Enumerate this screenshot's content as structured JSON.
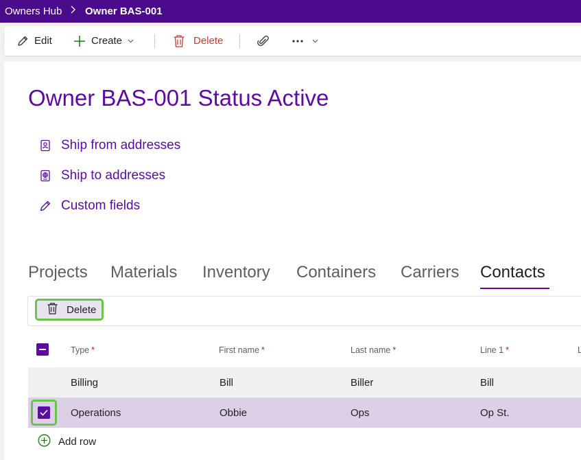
{
  "breadcrumb": {
    "root": "Owners Hub",
    "current": "Owner BAS-001"
  },
  "commands": {
    "edit": "Edit",
    "create": "Create",
    "delete": "Delete"
  },
  "record": {
    "title": "Owner BAS-001 Status Active"
  },
  "links": [
    {
      "label": "Ship from addresses",
      "icon": "contact-card-icon"
    },
    {
      "label": "Ship to addresses",
      "icon": "globe-card-icon"
    },
    {
      "label": "Custom fields",
      "icon": "pencil-icon"
    }
  ],
  "tabs": [
    {
      "label": "Projects",
      "active": false
    },
    {
      "label": "Materials",
      "active": false
    },
    {
      "label": "Inventory",
      "active": false
    },
    {
      "label": "Containers",
      "active": false
    },
    {
      "label": "Carriers",
      "active": false
    },
    {
      "label": "Contacts",
      "active": true
    }
  ],
  "subtoolbar": {
    "delete": "Delete"
  },
  "grid": {
    "columns": [
      {
        "label": "Type",
        "required": "*"
      },
      {
        "label": "First name",
        "required": "*"
      },
      {
        "label": "Last name",
        "required": "*"
      },
      {
        "label": "Line 1",
        "required": "*"
      },
      {
        "label": "L",
        "required": ""
      }
    ],
    "rows": [
      {
        "type": "Billing",
        "first": "Bill",
        "last": "Biller",
        "line1": "Bill",
        "selected": false
      },
      {
        "type": "Operations",
        "first": "Obbie",
        "last": "Ops",
        "line1": "Op St.",
        "selected": true
      }
    ],
    "add_row": "Add row"
  },
  "colors": {
    "header_bar": "#4b0a8c",
    "accent": "#5c0aa3",
    "highlight_border": "#6cc24a",
    "delete_red": "#c0403b",
    "add_green": "#107c10"
  }
}
